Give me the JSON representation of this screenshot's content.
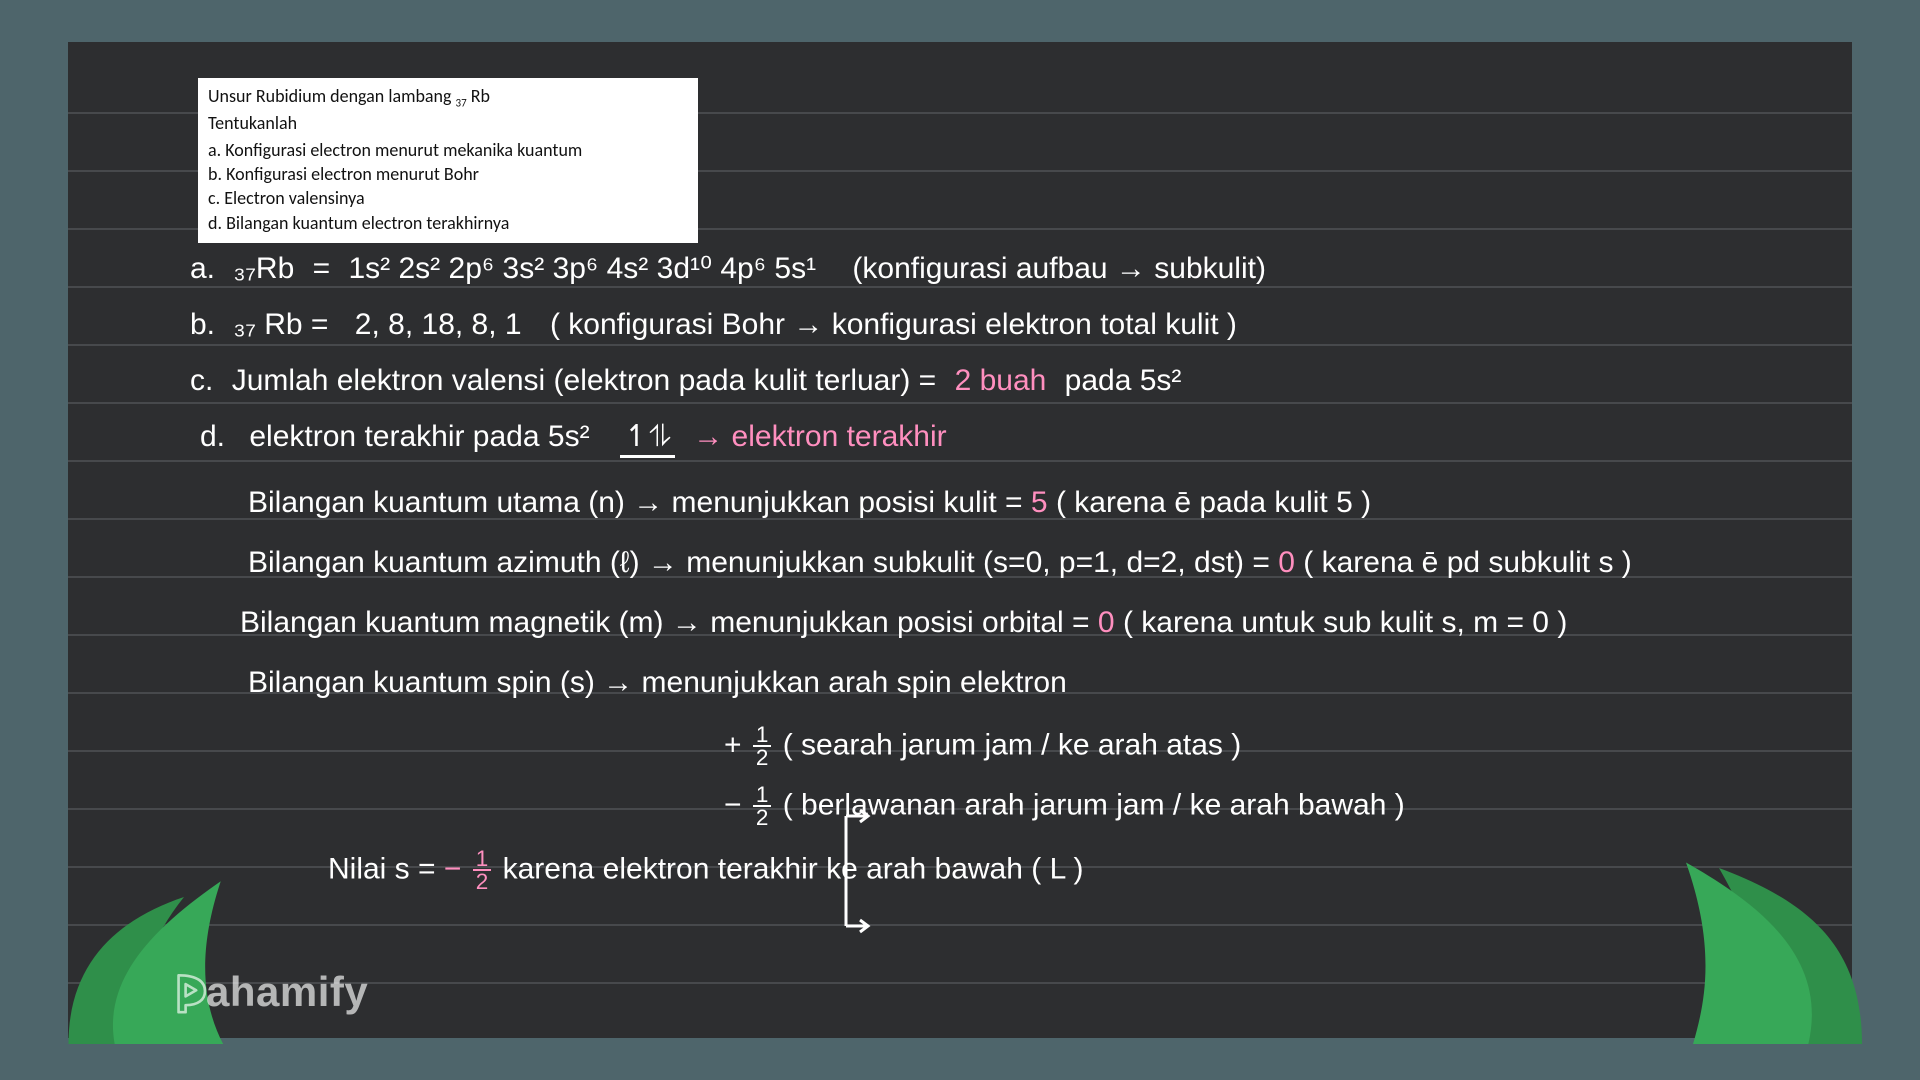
{
  "question": {
    "title_prefix": "Unsur Rubidium dengan lambang ",
    "symbol_sub": "37",
    "symbol": "Rb",
    "tentukanlah": "Tentukanlah",
    "items": {
      "a": "a.  Konfigurasi electron menurut mekanika kuantum",
      "b": "b.  Konfigurasi electron menurut  Bohr",
      "c": "c.  Electron valensinya",
      "d": "d.  Bilangan kuantum electron terakhirnya"
    }
  },
  "answers": {
    "a_label": "a.",
    "a_symbol": "₃₇Rb",
    "a_eq": "=",
    "a_config": "1s² 2s² 2p⁶ 3s² 3p⁶ 4s² 3d¹⁰ 4p⁶ 5s¹",
    "a_note": "(konfigurasi aufbau → subkulit)",
    "b_label": "b.",
    "b_symbol": "₃₇ Rb =",
    "b_config": "2, 8, 18, 8, 1",
    "b_note": "( konfigurasi Bohr → konfigurasi elektron total kulit )",
    "c_label": "c.",
    "c_text1": "Jumlah elektron valensi (elektron pada kulit terluar) =",
    "c_val": "2 buah",
    "c_text2": "pada 5s²",
    "d_label": "d.",
    "d_intro": "elektron terakhir pada   5s²",
    "d_1L": "↿⥮",
    "d_arrow_note": "→ elektron terakhir",
    "n_line": "Bilangan kuantum utama (n) → menunjukkan posisi kulit = ",
    "n_pink": "5",
    "n_tail": " ( karena ē pada kulit 5 )",
    "l_line": "Bilangan kuantum azimuth (ℓ) → menunjukkan subkulit (s=0, p=1, d=2, dst) = ",
    "l_pink": "0",
    "l_tail": " ( karena ē pd subkulit s )",
    "m_line": "Bilangan kuantum magnetik (m) → menunjukkan posisi orbital = ",
    "m_pink": "0",
    "m_tail": " ( karena untuk sub kulit s, m = 0 )",
    "s_line": "Bilangan kuantum spin (s) → menunjukkan arah spin elektron",
    "spin_plus_pre": "+",
    "spin_plus_post": " ( searah jarum jam / ke arah atas )",
    "spin_minus_pre": "−",
    "spin_minus_post": " ( berlawanan arah jarum jam / ke arah bawah )",
    "s_value_pre": "Nilai s = ",
    "s_value_post": "  karena elektron terakhir ke arah bawah  ( L )",
    "s_value_sign": "−",
    "half_num": "1",
    "half_den": "2"
  },
  "logo": "ahamify"
}
